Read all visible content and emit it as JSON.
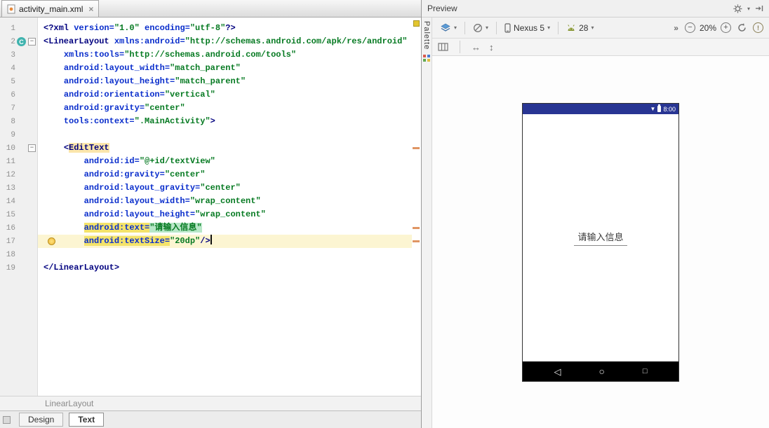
{
  "icons": {
    "close": "×",
    "dropdown": "▾",
    "overflow": "»",
    "zoom_out": "−",
    "zoom_in": "+",
    "error_mark": "!",
    "h_arrows": "↔",
    "v_arrows": "↕",
    "fold_collapse": "−",
    "c_badge": "C",
    "nav_back": "◁",
    "nav_home": "○",
    "nav_recents": "□",
    "wifi": "▼"
  },
  "colors": {
    "statusbar_blue": "#283593",
    "layers_blue": "#5b9bd5",
    "marker_orange": "#e09563"
  },
  "editor_tab": {
    "title": "activity_main.xml"
  },
  "bottom": {
    "breadcrumb": "LinearLayout",
    "tabs": [
      {
        "label": "Design",
        "active": false
      },
      {
        "label": "Text",
        "active": true
      }
    ]
  },
  "preview": {
    "title": "Preview",
    "palette_label": "Palette",
    "toolbar": {
      "device": "Nexus 5",
      "api": "28",
      "zoom": "20%"
    },
    "device": {
      "time": "8:00",
      "edit_text": "请输入信息"
    }
  },
  "editor": {
    "stripe_markers": [
      10,
      16,
      17
    ],
    "lines": [
      {
        "num": 1,
        "tokens": [
          [
            "<?xml ",
            "g"
          ],
          [
            "version=",
            "a"
          ],
          [
            "\"1.0\"",
            "v"
          ],
          [
            " ",
            "p"
          ],
          [
            "encoding=",
            "a"
          ],
          [
            "\"utf-8\"",
            "v"
          ],
          [
            "?>",
            "g"
          ]
        ]
      },
      {
        "num": 2,
        "icon": "c",
        "fold": true,
        "tokens": [
          [
            "<LinearLayout ",
            "g"
          ],
          [
            "xmlns:android=",
            "a"
          ],
          [
            "\"http://schemas.android.com/apk/res/android\"",
            "v"
          ]
        ]
      },
      {
        "num": 3,
        "tokens": [
          [
            "    ",
            "p"
          ],
          [
            "xmlns:tools=",
            "a"
          ],
          [
            "\"http://schemas.android.com/tools\"",
            "v"
          ]
        ]
      },
      {
        "num": 4,
        "tokens": [
          [
            "    ",
            "p"
          ],
          [
            "android:layout_width=",
            "a"
          ],
          [
            "\"match_parent\"",
            "v"
          ]
        ]
      },
      {
        "num": 5,
        "tokens": [
          [
            "    ",
            "p"
          ],
          [
            "android:layout_height=",
            "a"
          ],
          [
            "\"match_parent\"",
            "v"
          ]
        ]
      },
      {
        "num": 6,
        "tokens": [
          [
            "    ",
            "p"
          ],
          [
            "android:orientation=",
            "a"
          ],
          [
            "\"vertical\"",
            "v"
          ]
        ]
      },
      {
        "num": 7,
        "tokens": [
          [
            "    ",
            "p"
          ],
          [
            "android:gravity=",
            "a"
          ],
          [
            "\"center\"",
            "v"
          ]
        ]
      },
      {
        "num": 8,
        "tokens": [
          [
            "    ",
            "p"
          ],
          [
            "tools:context=",
            "a"
          ],
          [
            "\".MainActivity\"",
            "v"
          ],
          [
            ">",
            "g"
          ]
        ]
      },
      {
        "num": 9,
        "tokens": []
      },
      {
        "num": 10,
        "fold": true,
        "tokens": [
          [
            "    ",
            "p"
          ],
          [
            "<",
            "g"
          ],
          [
            "EditText",
            "g",
            "t"
          ]
        ]
      },
      {
        "num": 11,
        "tokens": [
          [
            "        ",
            "p"
          ],
          [
            "android:id=",
            "a"
          ],
          [
            "\"@+id/textView\"",
            "v"
          ]
        ]
      },
      {
        "num": 12,
        "tokens": [
          [
            "        ",
            "p"
          ],
          [
            "android:gravity=",
            "a"
          ],
          [
            "\"center\"",
            "v"
          ]
        ]
      },
      {
        "num": 13,
        "tokens": [
          [
            "        ",
            "p"
          ],
          [
            "android:layout_gravity=",
            "a"
          ],
          [
            "\"center\"",
            "v"
          ]
        ]
      },
      {
        "num": 14,
        "tokens": [
          [
            "        ",
            "p"
          ],
          [
            "android:layout_width=",
            "a"
          ],
          [
            "\"wrap_content\"",
            "v"
          ]
        ]
      },
      {
        "num": 15,
        "tokens": [
          [
            "        ",
            "p"
          ],
          [
            "android:layout_height=",
            "a"
          ],
          [
            "\"wrap_content\"",
            "v"
          ]
        ]
      },
      {
        "num": 16,
        "tokens": [
          [
            "        ",
            "p"
          ],
          [
            "android:text=",
            "a",
            "y"
          ],
          [
            "\"请输入信息\"",
            "v",
            "gr"
          ]
        ]
      },
      {
        "num": 17,
        "current": true,
        "bulb": true,
        "caret": true,
        "tokens": [
          [
            "        ",
            "p"
          ],
          [
            "android:textSize=",
            "a",
            "y"
          ],
          [
            "\"20dp\"",
            "v"
          ],
          [
            "/>",
            "g"
          ]
        ]
      },
      {
        "num": 18,
        "tokens": []
      },
      {
        "num": 19,
        "tokens": [
          [
            "</LinearLayout>",
            "g"
          ]
        ]
      }
    ]
  }
}
